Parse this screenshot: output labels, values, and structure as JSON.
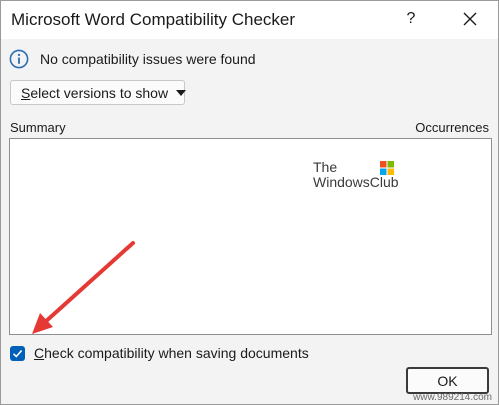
{
  "window": {
    "title": "Microsoft Word Compatibility Checker",
    "help_label": "?",
    "close_icon": "close-icon"
  },
  "info": {
    "icon": "info-icon",
    "message": "No compatibility issues were found"
  },
  "versions_button": {
    "underlined_char": "S",
    "rest": "elect versions to show",
    "icon": "caret-down-icon"
  },
  "columns": {
    "summary": "Summary",
    "occurrences": "Occurrences"
  },
  "watermark": {
    "line1": "The",
    "line2": "WindowsClub"
  },
  "check_option": {
    "checked": true,
    "underlined_char": "C",
    "rest": "heck compatibility when saving documents"
  },
  "ok_button": {
    "label": "OK"
  },
  "credit": {
    "text": "www.989214.com"
  },
  "colors": {
    "accent": "#005fb8",
    "annotation_arrow": "#e53935"
  }
}
